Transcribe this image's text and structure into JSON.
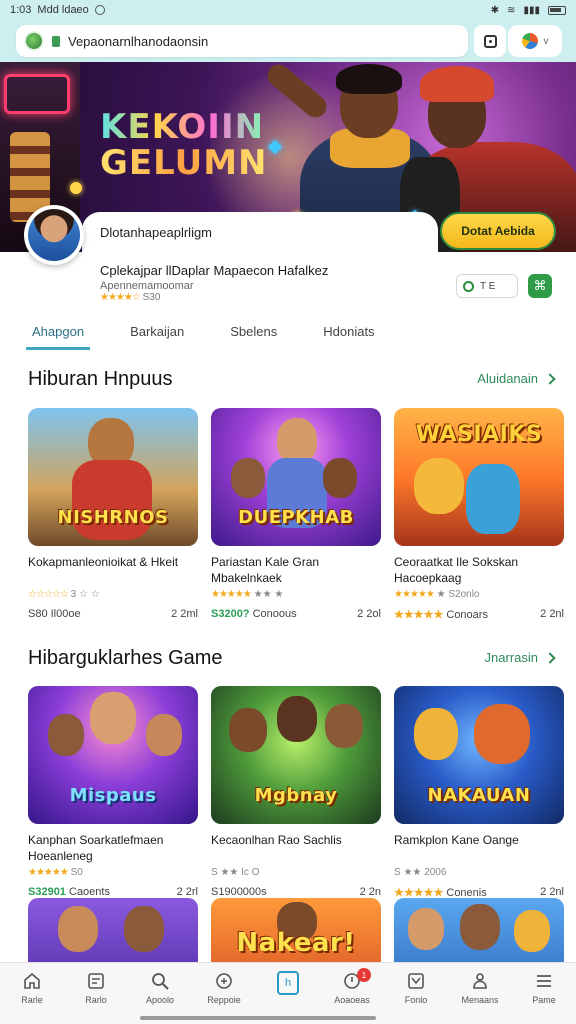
{
  "status_bar": {
    "time": "1:03",
    "carrier": "Mdd ldaeo"
  },
  "address_bar": {
    "url": "Vepaonarnlhanodaonsin",
    "account_label": "v"
  },
  "hero": {
    "title_line1": "KEKOIIN",
    "title_line2": "GELUMN"
  },
  "profile": {
    "name": "Dlotanhapeaplrligm",
    "cta_label": "Dotat Aebida",
    "app_title": "Cplekajpar llDaplar Mapaecon Hafalkez",
    "app_subtitle": "Apennemamoomar",
    "rating_stars": "★★★★☆",
    "rating_value": "S30",
    "chip_label": "T E",
    "share_icon": "share-icon"
  },
  "tabs": [
    {
      "label": "Ahapgon",
      "active": true
    },
    {
      "label": "Barkaijan",
      "active": false
    },
    {
      "label": "Sbelens",
      "active": false
    },
    {
      "label": "Hdoniats",
      "active": false
    }
  ],
  "section1": {
    "title": "Hiburan Hnpuus",
    "link": "Aluidanain",
    "cards": [
      {
        "thumb_word": "NISHRNOS",
        "title": "Kokapmanleonioikat & Hkeit",
        "stars": "☆☆☆☆☆",
        "rating": "3 ☆ ☆",
        "price": "S80 Il00oe",
        "size": "2 2ml",
        "accent": "#e2552c"
      },
      {
        "thumb_word": "DUEPKHAB",
        "title": "Pariastan Kale Gran Mbakelnkaek",
        "stars": "★★★★★",
        "rating": "★★ ★",
        "price": "S3200?",
        "extra": "Conoous",
        "size": "2 2ol",
        "accent": "#8a4fd6"
      },
      {
        "thumb_word": "WASIAIKS",
        "title": "Ceoraatkat Ile Sokskan Hacoepkaag",
        "stars": "★★★★★",
        "rating": "★ S2onlo",
        "price": "★★★★★",
        "extra": "Conoars",
        "size": "2 2nl",
        "accent": "#f07a2a"
      }
    ]
  },
  "section2": {
    "title": "Hibarguklarhes Game",
    "link": "Jnarrasin",
    "cards": [
      {
        "thumb_word": "Mispaus",
        "title": "Kanphan Soarkatlefmaen Hoeanleneg",
        "stars": "★★★★★",
        "rating": "S0",
        "price": "S32901",
        "extra": "Caoents",
        "size": "2 2rl",
        "accent": "#7a3fd0"
      },
      {
        "thumb_word": "Mgbnay",
        "title": "Kecaonlhan Rao Sachlis",
        "stars": "",
        "rating": "S ★★ Ic O",
        "price": "S1900000s",
        "size": "2 2n",
        "accent": "#3c8a3c"
      },
      {
        "thumb_word": "NAKAUAN",
        "title": "Ramkplon Kane Oange",
        "stars": "",
        "rating": "S ★★ 2006",
        "price": "★★★★★",
        "extra": "Conenis",
        "size": "2 2nl",
        "accent": "#2c5fc8"
      }
    ]
  },
  "section3": {
    "cards": [
      {
        "thumb_word": "",
        "accent": "#6a3acb"
      },
      {
        "thumb_word": "Nakear!",
        "accent": "#e0572a"
      },
      {
        "thumb_word": "",
        "accent": "#2f6fc9"
      }
    ]
  },
  "bottom_nav": [
    {
      "label": "Rarle",
      "icon": "home-icon"
    },
    {
      "label": "Rarlo",
      "icon": "window-icon"
    },
    {
      "label": "Apoolo",
      "icon": "search-icon"
    },
    {
      "label": "Reppoie",
      "icon": "game-icon"
    },
    {
      "label": "h",
      "icon": "bookmark-icon",
      "active": true
    },
    {
      "label": "Aoaoeas",
      "icon": "notification-icon",
      "badge": "1"
    },
    {
      "label": "Fonlo",
      "icon": "download-icon"
    },
    {
      "label": "Menaans",
      "icon": "profile-icon"
    },
    {
      "label": "Pame",
      "icon": "menu-icon"
    }
  ]
}
